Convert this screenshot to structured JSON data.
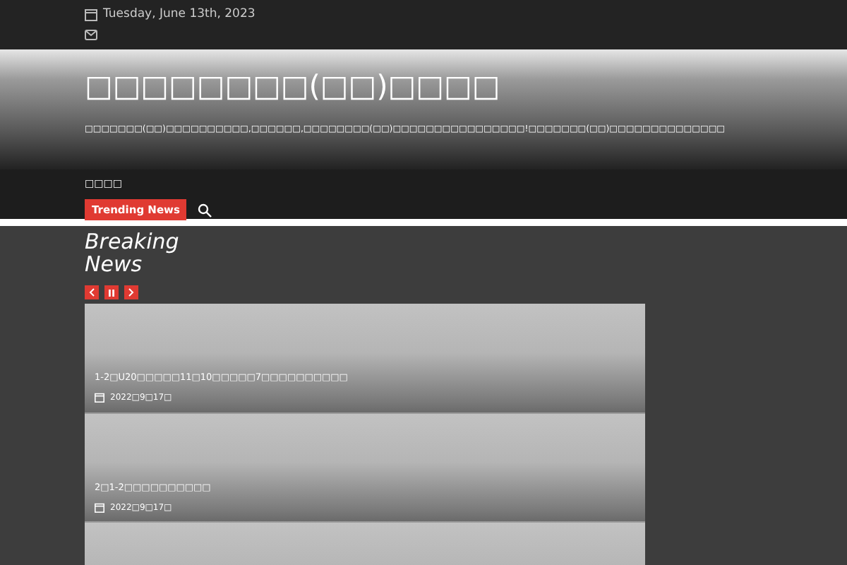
{
  "top_bar": {
    "date": "Tuesday, June 13th, 2023"
  },
  "header": {
    "site_title": "□□□□□□□□(□□)□□□□",
    "tagline": "□□□□□□□(□□)□□□□□□□□□□,□□□□□□,□□□□□□□□(□□)□□□□□□□□□□□□□□□□!□□□□□□□(□□)□□□□□□□□□□□□□□"
  },
  "nav": {
    "items": [
      {
        "label": "□□□□",
        "selected": false
      }
    ],
    "trending_label": "Trending News"
  },
  "breaking": {
    "title": "Breaking News",
    "controls": [
      {
        "kind": "prev"
      },
      {
        "kind": "pause"
      },
      {
        "kind": "next"
      }
    ],
    "slides": [
      {
        "title": "1-2□U20□□□□□11□10□□□□□7□□□□□□□□□□",
        "date": "2022□9□17□"
      },
      {
        "title": "2□1-2□□□□□□□□□□",
        "date": "2022□9□17□"
      }
    ]
  }
}
